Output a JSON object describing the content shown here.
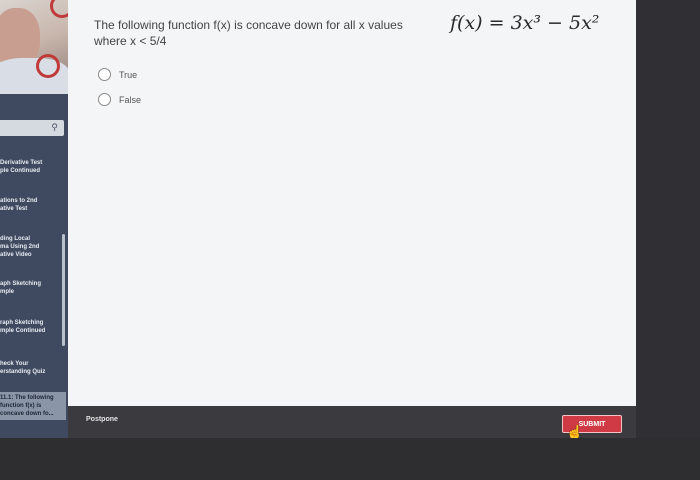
{
  "question": {
    "text": "The following function f(x) is concave down for all x values\nwhere x < 5/4",
    "formula": "f(x) = 3x³ − 5x²"
  },
  "options": [
    {
      "label": "True"
    },
    {
      "label": "False"
    }
  ],
  "sidebar": {
    "items": [
      {
        "label": "Derivative Test\nple Continued"
      },
      {
        "label": "ations to 2nd\native Test"
      },
      {
        "label": "ding Local\nma Using 2nd\native Video"
      },
      {
        "label": "aph Sketching\nmple"
      },
      {
        "label": "raph Sketching\nmple Continued"
      },
      {
        "label": "heck Your\nerstanding Quiz"
      },
      {
        "label": "11.1: The following\nfunction f(x) is\nconcave down fo..."
      }
    ]
  },
  "footer": {
    "postpone_label": "Postpone",
    "submit_label": "SUBMIT"
  }
}
